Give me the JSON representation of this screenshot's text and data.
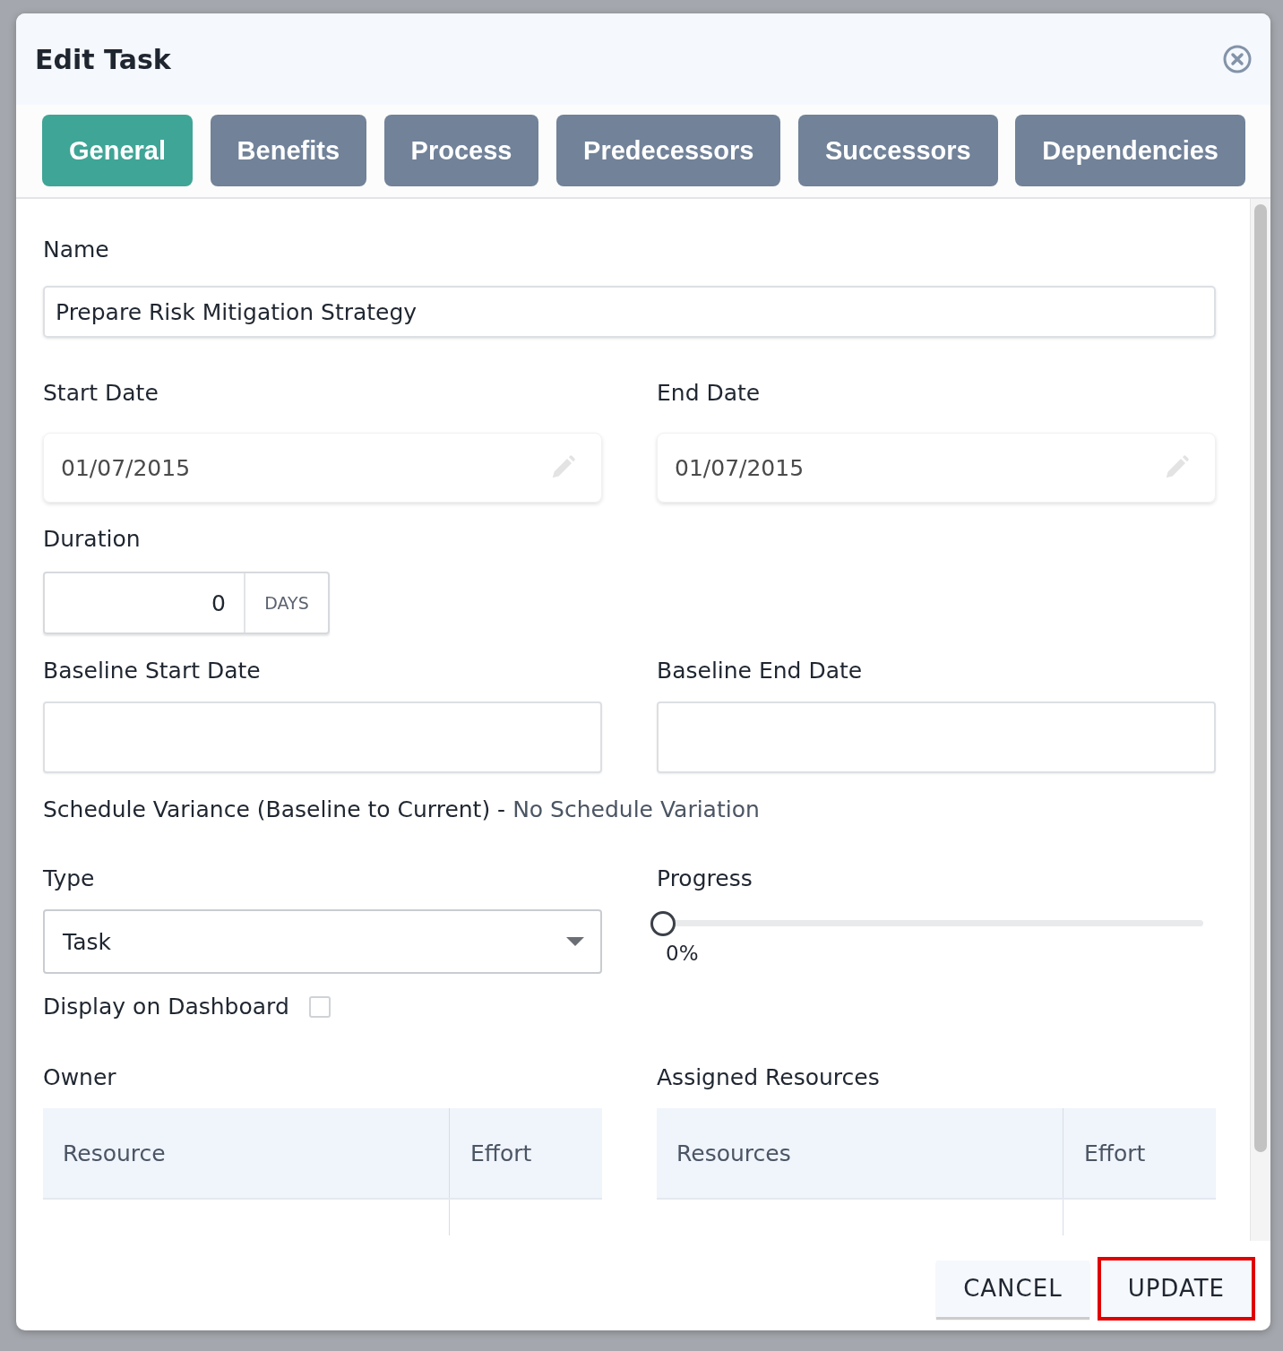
{
  "dialog": {
    "title": "Edit Task"
  },
  "tabs": [
    {
      "label": "General",
      "selected": true
    },
    {
      "label": "Benefits",
      "selected": false
    },
    {
      "label": "Process",
      "selected": false
    },
    {
      "label": "Predecessors",
      "selected": false
    },
    {
      "label": "Successors",
      "selected": false
    },
    {
      "label": "Dependencies",
      "selected": false
    }
  ],
  "form": {
    "name": {
      "label": "Name",
      "value": "Prepare Risk Mitigation Strategy"
    },
    "start_date": {
      "label": "Start Date",
      "value": "01/07/2015"
    },
    "end_date": {
      "label": "End Date",
      "value": "01/07/2015"
    },
    "duration": {
      "label": "Duration",
      "value": "0",
      "unit": "DAYS"
    },
    "baseline_start_date": {
      "label": "Baseline Start Date"
    },
    "baseline_end_date": {
      "label": "Baseline End Date"
    },
    "schedule_variance": {
      "label": "Schedule Variance (Baseline to Current) -",
      "value": "No Schedule Variation"
    },
    "type": {
      "label": "Type",
      "value": "Task"
    },
    "progress": {
      "label": "Progress",
      "level": 0,
      "reading": "0%"
    },
    "display_on_dashboard": {
      "label": "Display on Dashboard",
      "checked": false
    },
    "owner": {
      "label": "Owner",
      "columns": [
        "Resource",
        "Effort"
      ]
    },
    "assigned_resources": {
      "label": "Assigned Resources",
      "columns": [
        "Resources",
        "Effort"
      ]
    }
  },
  "buttons": [
    {
      "label": "CANCEL",
      "highlighted": false
    },
    {
      "label": "UPDATE",
      "highlighted": true
    }
  ]
}
